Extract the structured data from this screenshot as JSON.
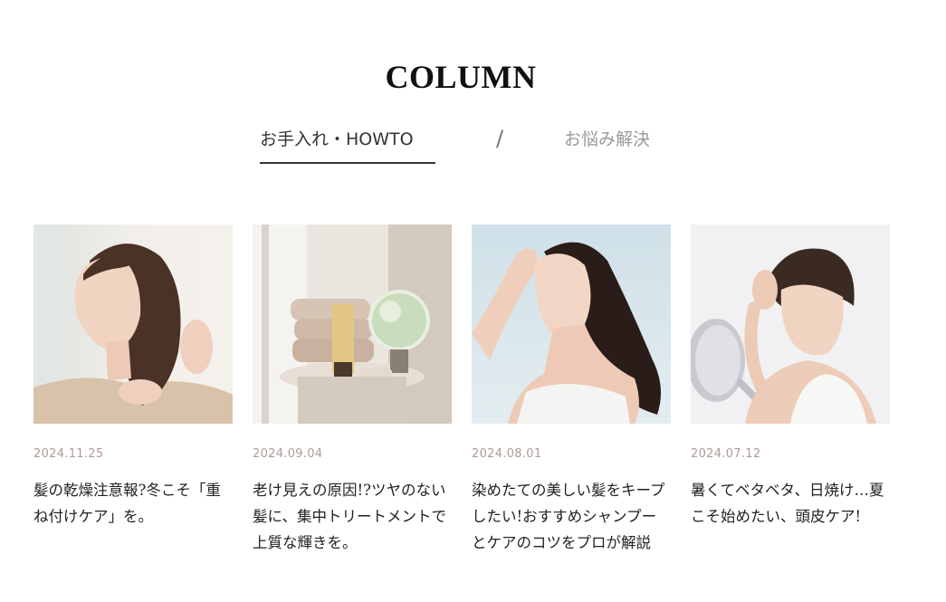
{
  "header": {
    "title": "COLUMN"
  },
  "tabs": [
    {
      "label": "お手入れ・HOWTO",
      "active": true
    },
    {
      "label": "お悩み解決",
      "active": false
    }
  ],
  "tab_separator": "/",
  "articles": [
    {
      "date": "2024.11.25",
      "title": "髪の乾燥注意報?冬こそ「重ね付けケア」を。"
    },
    {
      "date": "2024.09.04",
      "title": "老け見えの原因!?ツヤのない髪に、集中トリートメントで上質な輝きを。"
    },
    {
      "date": "2024.08.01",
      "title": "染めたての美しい髪をキープしたい!おすすめシャンプーとケアのコツをプロが解説"
    },
    {
      "date": "2024.07.12",
      "title": "暑くてベタベタ、日焼け…夏こそ始めたい、頭皮ケア!"
    }
  ],
  "colors": {
    "tab_active": "#333333",
    "tab_inactive": "#999999",
    "date": "#b09a98"
  }
}
